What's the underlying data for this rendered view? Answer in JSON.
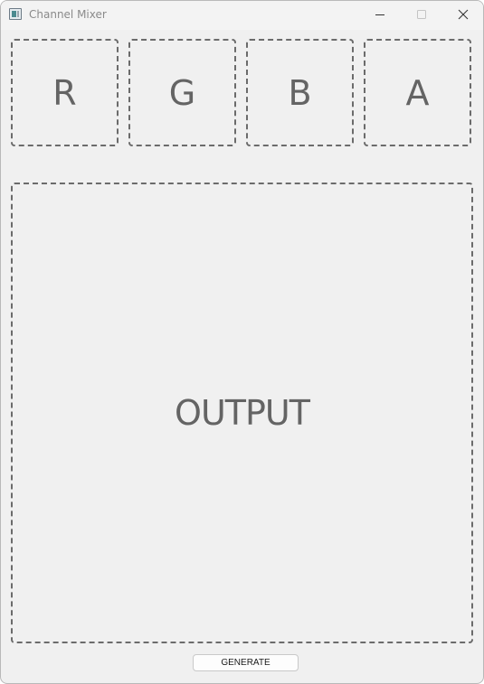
{
  "window": {
    "title": "Channel Mixer",
    "icon": "app-window-icon"
  },
  "title_controls": {
    "minimize_icon": "minimize-icon",
    "maximize_icon": "maximize-icon",
    "close_icon": "close-icon"
  },
  "channels": [
    {
      "label": "R"
    },
    {
      "label": "G"
    },
    {
      "label": "B"
    },
    {
      "label": "A"
    }
  ],
  "output": {
    "label": "OUTPUT"
  },
  "actions": {
    "generate_label": "GENERATE"
  },
  "colors": {
    "window_bg": "#f0f0f0",
    "dashed_border": "#6b6b6b",
    "label_text": "#646464"
  }
}
